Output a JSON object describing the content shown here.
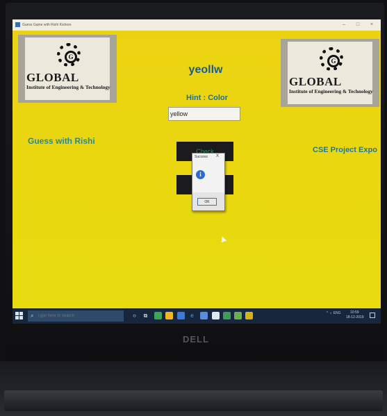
{
  "window": {
    "title": "Guess Game with Rishi Kishore",
    "minimize": "–",
    "maximize": "□",
    "close": "×"
  },
  "logo": {
    "title": "GLOBAL",
    "subtitle": "Institute of Engineering & Technology",
    "mark": "G"
  },
  "game": {
    "scrambled_word": "yeollw",
    "hint": "Hint : Color",
    "guess_value": "yellow",
    "left_caption": "Guess with Rishi",
    "right_caption": "CSE Project Expo",
    "check_label": "Check"
  },
  "dialog": {
    "title": "Success",
    "close": "X",
    "icon": "i",
    "ok_label": "OK"
  },
  "taskbar": {
    "search_placeholder": "Type here to search",
    "tray": "^ ☼ ENG",
    "time": "10:59",
    "date": "18-12-2019"
  },
  "brand": "DELL",
  "colors": {
    "app_background": "#e9d80e",
    "word": "#1a5d8c",
    "caption": "#1f8aa8",
    "taskbar": "#17263c"
  },
  "icons": [
    "info-icon",
    "search-icon",
    "windows-start-icon",
    "gear-logo-icon"
  ]
}
